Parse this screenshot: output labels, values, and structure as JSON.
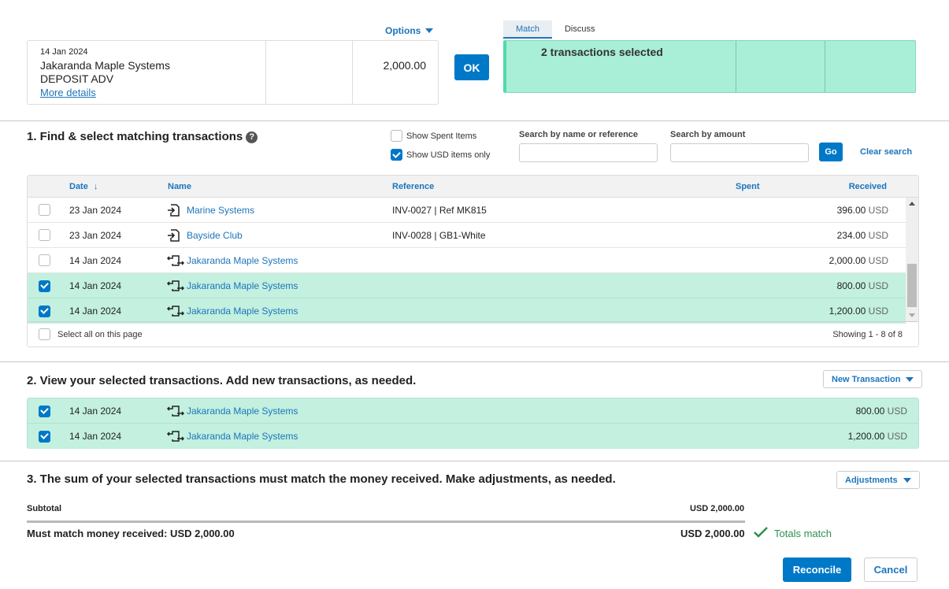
{
  "statement": {
    "options_label": "Options",
    "date": "14 Jan 2024",
    "payee": "Jakaranda Maple Systems",
    "description": "DEPOSIT ADV",
    "more_details": "More details",
    "spent": "",
    "received": "2,000.00",
    "ok_label": "OK"
  },
  "match_panel": {
    "tabs": [
      {
        "label": "Match",
        "active": true
      },
      {
        "label": "Discuss",
        "active": false
      }
    ],
    "summary": "2 transactions selected"
  },
  "section1": {
    "title": "1. Find & select matching transactions",
    "help_icon": "?",
    "show_spent": {
      "label": "Show Spent Items",
      "checked": false
    },
    "show_usd": {
      "label": "Show USD items only",
      "checked": true
    },
    "search_name": {
      "label": "Search by name or reference",
      "value": "",
      "placeholder": ""
    },
    "search_amount": {
      "label": "Search by amount",
      "value": "",
      "placeholder": ""
    },
    "go_label": "Go",
    "clear_label": "Clear search",
    "columns": {
      "date": "Date",
      "sort_icon": "↓",
      "name": "Name",
      "reference": "Reference",
      "spent": "Spent",
      "received": "Received"
    },
    "rows": [
      {
        "checked": false,
        "date": "23 Jan 2024",
        "icon": "invoice-icon",
        "name": "Marine Systems",
        "reference": "INV-0027 | Ref MK815",
        "spent": "",
        "received": "396.00",
        "currency": "USD"
      },
      {
        "checked": false,
        "date": "23 Jan 2024",
        "icon": "invoice-icon",
        "name": "Bayside Club",
        "reference": "INV-0028 | GB1-White",
        "spent": "",
        "received": "234.00",
        "currency": "USD"
      },
      {
        "checked": false,
        "date": "14 Jan 2024",
        "icon": "transfer-icon",
        "name": "Jakaranda Maple Systems",
        "reference": "",
        "spent": "",
        "received": "2,000.00",
        "currency": "USD"
      },
      {
        "checked": true,
        "date": "14 Jan 2024",
        "icon": "transfer-icon",
        "name": "Jakaranda Maple Systems",
        "reference": "",
        "spent": "",
        "received": "800.00",
        "currency": "USD"
      },
      {
        "checked": true,
        "date": "14 Jan 2024",
        "icon": "transfer-icon",
        "name": "Jakaranda Maple Systems",
        "reference": "",
        "spent": "",
        "received": "1,200.00",
        "currency": "USD"
      }
    ],
    "select_all_label": "Select all on this page",
    "showing": "Showing 1 - 8 of 8"
  },
  "section2": {
    "title": "2. View your selected transactions. Add new transactions, as needed.",
    "new_transaction_label": "New Transaction",
    "rows": [
      {
        "checked": true,
        "date": "14 Jan 2024",
        "icon": "transfer-icon",
        "name": "Jakaranda Maple Systems",
        "received": "800.00",
        "currency": "USD"
      },
      {
        "checked": true,
        "date": "14 Jan 2024",
        "icon": "transfer-icon",
        "name": "Jakaranda Maple Systems",
        "received": "1,200.00",
        "currency": "USD"
      }
    ]
  },
  "section3": {
    "title": "3. The sum of your selected transactions must match the money received. Make adjustments, as needed.",
    "adjustments_label": "Adjustments",
    "subtotal_label": "Subtotal",
    "subtotal_value": "USD 2,000.00",
    "must_match_label": "Must match money received: USD 2,000.00",
    "must_match_value": "USD 2,000.00",
    "totals_match": "Totals match"
  },
  "actions": {
    "reconcile_label": "Reconcile",
    "cancel_label": "Cancel"
  },
  "colors": {
    "accent": "#0078c8",
    "selected_row": "#c3f0df",
    "match_panel": "#a9eed6",
    "success": "#2f8f4e"
  }
}
